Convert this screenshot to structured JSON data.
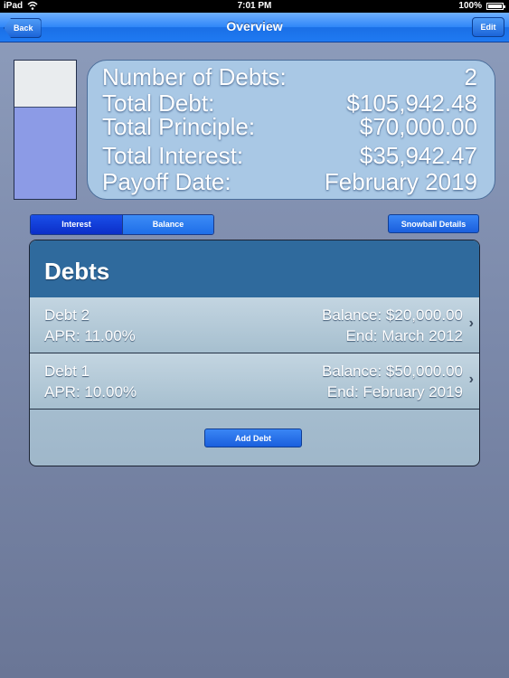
{
  "status_bar": {
    "carrier": "iPad",
    "time": "7:01 PM",
    "battery": "100%"
  },
  "nav": {
    "back_label": "Back",
    "title": "Overview",
    "edit_label": "Edit"
  },
  "mini_chart": {
    "interest": 35942.47,
    "principal": 70000.0,
    "interest_color": "#e9ecee",
    "principal_color": "#8c9be6"
  },
  "summary": {
    "rows": [
      {
        "label": "Number of Debts:",
        "value": "2"
      },
      {
        "label": "Total Debt:",
        "value": "$105,942.48"
      },
      {
        "label": "Total Principle:",
        "value": "$70,000.00"
      },
      {
        "label": "Total Interest:",
        "value": "$35,942.47"
      },
      {
        "label": "Payoff Date:",
        "value": "February 2019"
      }
    ]
  },
  "segmented": {
    "options": [
      "Interest",
      "Balance"
    ],
    "selected": "Interest"
  },
  "snowball_label": "Snowball Details",
  "debts": {
    "title": "Debts",
    "items": [
      {
        "name": "Debt 2",
        "apr": "APR: 11.00%",
        "balance": "Balance: $20,000.00",
        "end": "End: March 2012"
      },
      {
        "name": "Debt 1",
        "apr": "APR: 10.00%",
        "balance": "Balance: $50,000.00",
        "end": "End: February 2019"
      }
    ],
    "add_label": "Add Debt"
  }
}
